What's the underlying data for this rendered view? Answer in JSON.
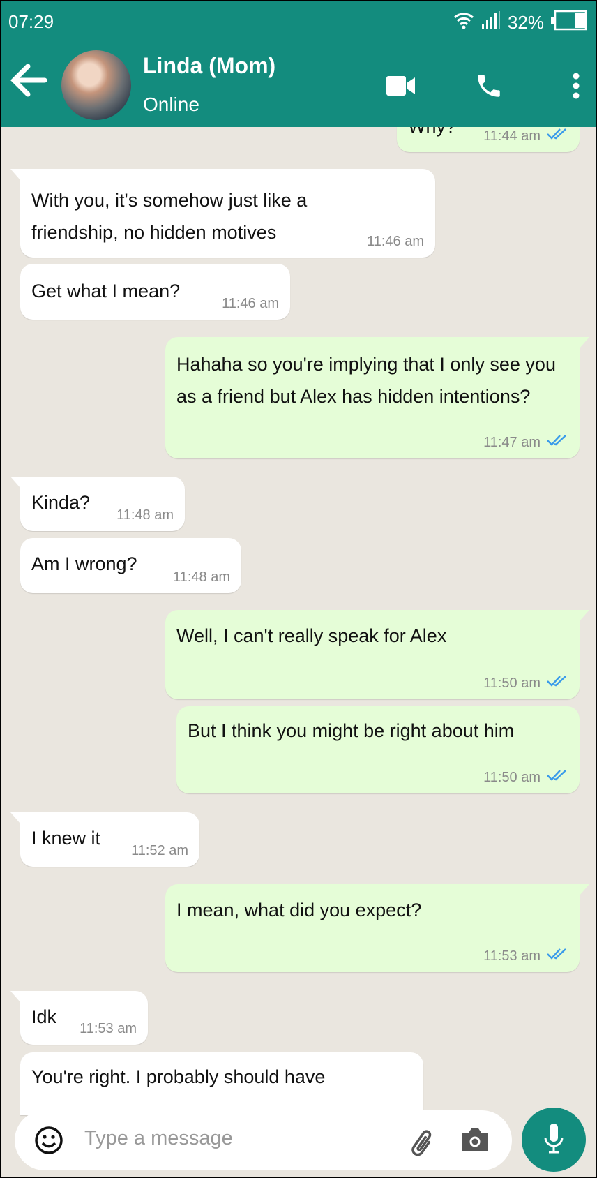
{
  "status_bar": {
    "time": "07:29",
    "battery": "32%"
  },
  "header": {
    "contact_name": "Linda (Mom)",
    "status": "Online",
    "accent": "#138C7E"
  },
  "messages": [
    {
      "dir": "out",
      "text": "Why?",
      "time": "11:44 am",
      "ticks": "read"
    },
    {
      "dir": "in",
      "text": "With you, it's somehow just like a friendship, no hidden motives",
      "time": "11:46 am"
    },
    {
      "dir": "in",
      "text": "Get what I mean?",
      "time": "11:46 am"
    },
    {
      "dir": "out",
      "text": "Hahaha so you're implying that I only see you as a friend but Alex has hidden intentions?",
      "time": "11:47 am",
      "ticks": "read"
    },
    {
      "dir": "in",
      "text": "Kinda?",
      "time": "11:48 am"
    },
    {
      "dir": "in",
      "text": "Am I wrong?",
      "time": "11:48 am"
    },
    {
      "dir": "out",
      "text": "Well, I can't really speak for Alex",
      "time": "11:50 am",
      "ticks": "read"
    },
    {
      "dir": "out",
      "text": "But I think you might be right about him",
      "time": "11:50 am",
      "ticks": "read"
    },
    {
      "dir": "in",
      "text": "I knew it",
      "time": "11:52 am"
    },
    {
      "dir": "out",
      "text": "I mean, what did you expect?",
      "time": "11:53 am",
      "ticks": "read"
    },
    {
      "dir": "in",
      "text": "Idk",
      "time": "11:53 am"
    },
    {
      "dir": "in",
      "text": "You're right. I probably should have",
      "time": ""
    }
  ],
  "composer": {
    "placeholder": "Type a message"
  }
}
